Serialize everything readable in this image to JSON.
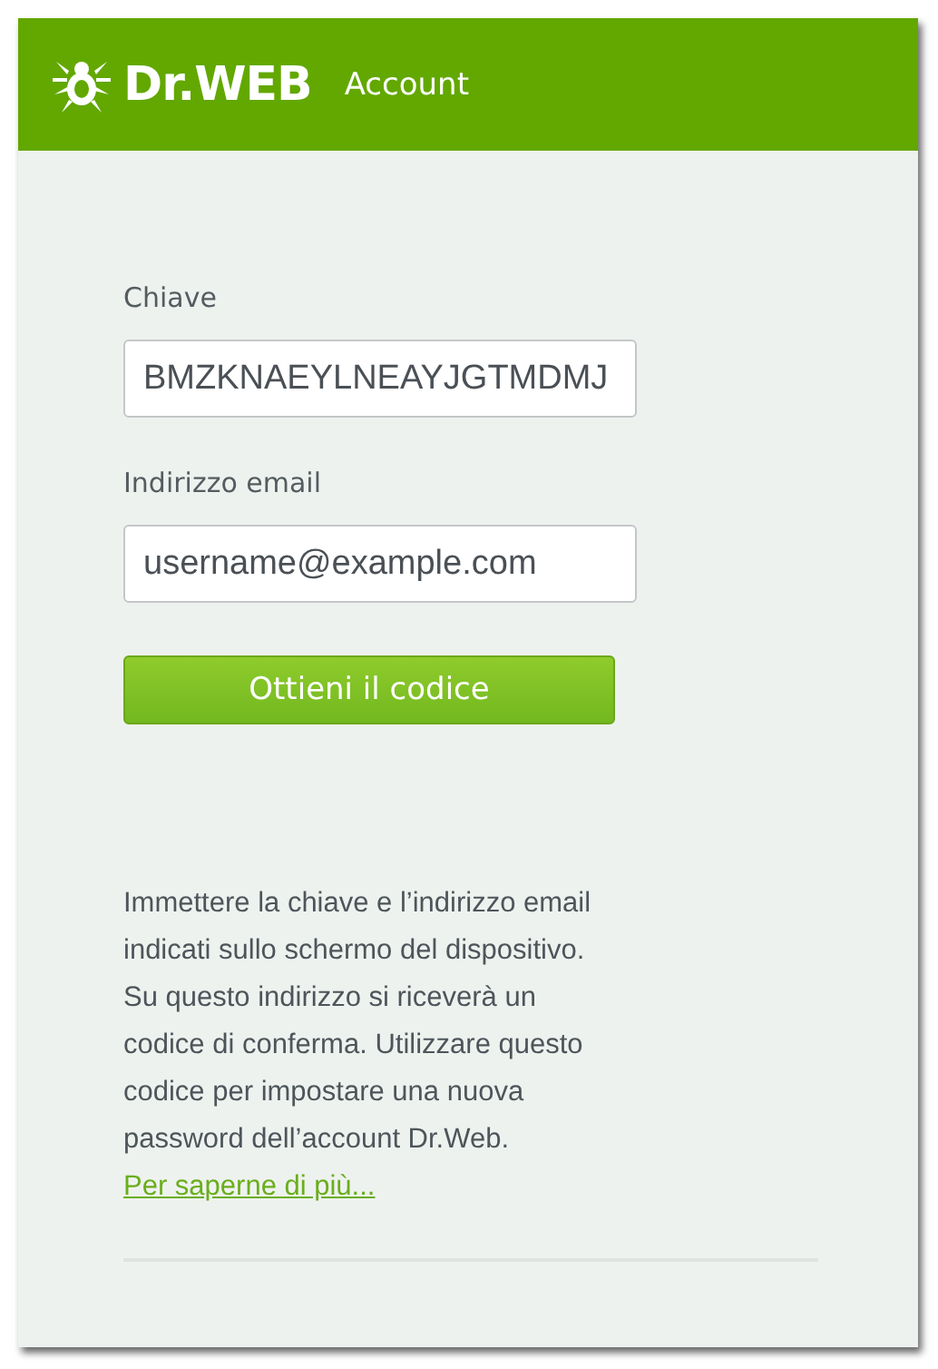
{
  "header": {
    "logo": "Dr.WEB",
    "title": "Account"
  },
  "fields": [
    {
      "label": "Chiave",
      "value": "BMZKNAEYLNEAYJGTMDMJ"
    },
    {
      "label": "Indirizzo email",
      "value": "username@example.com"
    }
  ],
  "button": "Ottieni il codice",
  "info": "Immettere la chiave e l’indirizzo email indicati sullo schermo del dispositivo. Su questo indirizzo si riceverà un codice di conferma. Utilizzare questo codice per impostare una nuova password dell’account Dr.Web.",
  "link": "Per saperne di più..."
}
